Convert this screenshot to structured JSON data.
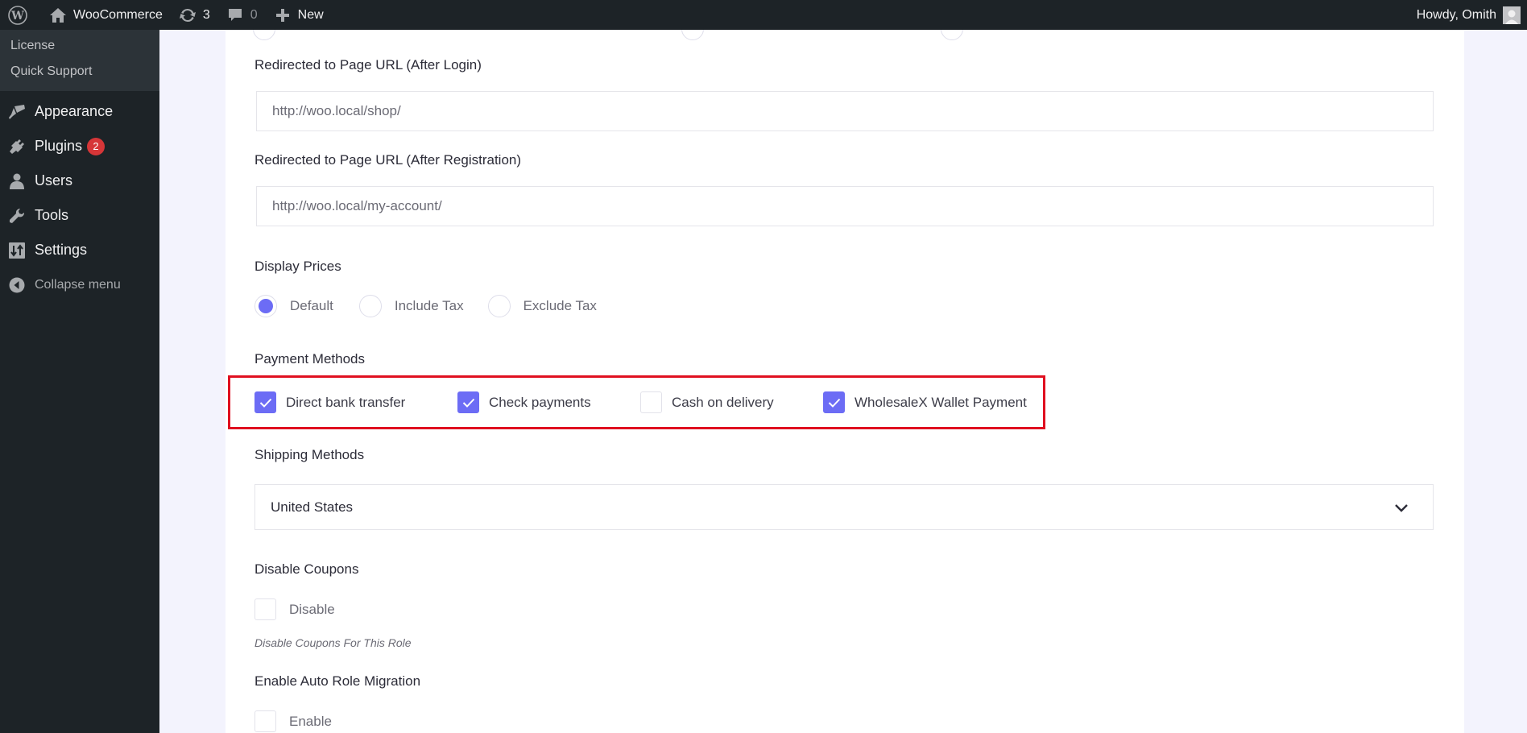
{
  "adminbar": {
    "wp_logo": "wordpress-logo",
    "site_name": "WooCommerce",
    "updates_count": "3",
    "comments_count": "0",
    "new_label": "New",
    "greeting": "Howdy, Omith"
  },
  "sidebar": {
    "submenu": [
      {
        "label": "License"
      },
      {
        "label": "Quick Support"
      }
    ],
    "items": [
      {
        "label": "Appearance",
        "icon": "paintbrush-icon"
      },
      {
        "label": "Plugins",
        "icon": "plug-icon",
        "badge": "2"
      },
      {
        "label": "Users",
        "icon": "user-icon"
      },
      {
        "label": "Tools",
        "icon": "wrench-icon"
      },
      {
        "label": "Settings",
        "icon": "sliders-icon"
      }
    ],
    "collapse_label": "Collapse menu"
  },
  "form": {
    "redirect_login": {
      "label": "Redirected to Page URL (After Login)",
      "value": "http://woo.local/shop/"
    },
    "redirect_registration": {
      "label": "Redirected to Page URL (After Registration)",
      "value": "http://woo.local/my-account/"
    },
    "display_prices": {
      "label": "Display Prices",
      "options": [
        {
          "label": "Default",
          "checked": true
        },
        {
          "label": "Include Tax",
          "checked": false
        },
        {
          "label": "Exclude Tax",
          "checked": false
        }
      ]
    },
    "payment_methods": {
      "label": "Payment Methods",
      "options": [
        {
          "label": "Direct bank transfer",
          "checked": true
        },
        {
          "label": "Check payments",
          "checked": true
        },
        {
          "label": "Cash on delivery",
          "checked": false
        },
        {
          "label": "WholesaleX Wallet Payment",
          "checked": true
        }
      ]
    },
    "shipping_methods": {
      "label": "Shipping Methods",
      "selected": "United States"
    },
    "disable_coupons": {
      "label": "Disable Coupons",
      "option_label": "Disable",
      "checked": false,
      "helper": "Disable Coupons For This Role"
    },
    "auto_role_migration": {
      "label": "Enable Auto Role Migration",
      "option_label": "Enable",
      "checked": false
    }
  },
  "colors": {
    "accent": "#6c6cf5",
    "highlight_border": "#e01020",
    "adminbar_bg": "#1d2327",
    "badge": "#d63638"
  }
}
